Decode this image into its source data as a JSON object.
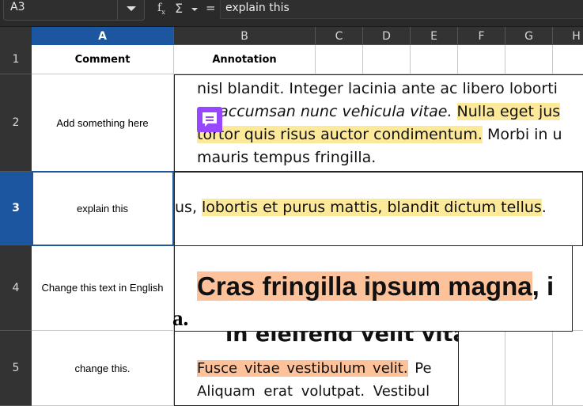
{
  "formula_bar": {
    "name_box": "A3",
    "formula": "explain this",
    "icons": [
      "fx-icon",
      "sigma-icon",
      "equals-icon"
    ]
  },
  "columns": [
    "A",
    "B",
    "C",
    "D",
    "E",
    "F",
    "G",
    "H"
  ],
  "selected_column": "A",
  "rows": [
    "1",
    "2",
    "3",
    "4",
    "5"
  ],
  "selected_row": "3",
  "cells": {
    "A1": "Comment",
    "B1": "Annotation",
    "A2": "Add something here",
    "A3": "explain this",
    "A4": "Change this text in English",
    "A5": "change this."
  },
  "images": {
    "row2": {
      "lines": [
        "nisl blandit. Integer lacinia ante ac libero loborti",
        "ac accumsan nunc vehicula vitae.",
        "Nulla eget jus",
        "tortor quis risus auctor condimentum.",
        "Morbi in u",
        "mauris tempus fringilla."
      ]
    },
    "row3": {
      "prefix": "us, ",
      "highlight": "lobortis et purus mattis, blandit dictum tellus",
      "suffix": "."
    },
    "row4": {
      "highlight": "Cras fringilla ipsum magna",
      "suffix": ", i",
      "spill": "a."
    },
    "row5": {
      "heading": "in eleifend velit vitae",
      "highlight": "Fusce vitae vestibulum velit.",
      "suffix": " Pe",
      "line2": "Aliquam erat volutpat. Vestibul"
    }
  },
  "colors": {
    "selection": "#1c56a0",
    "highlight_yellow": "#fde99a",
    "highlight_orange": "#fec29a",
    "comment_icon": "#9747ff"
  }
}
